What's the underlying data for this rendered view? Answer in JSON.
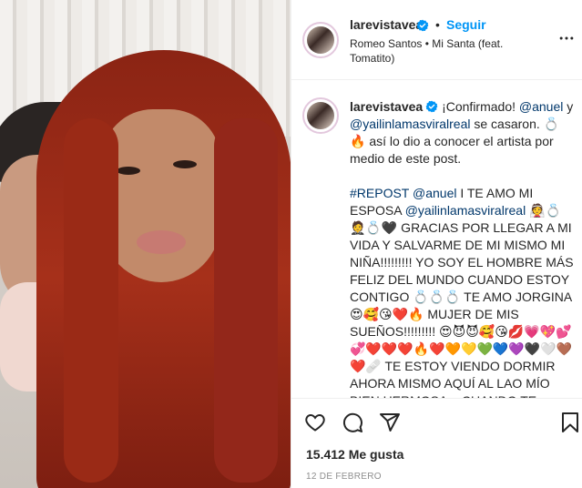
{
  "post": {
    "author": {
      "username": "larevistavea",
      "follow_label": "Seguir",
      "dot": "•"
    },
    "audio": "Romeo Santos • Mi Santa (feat. Tomatito)",
    "caption": {
      "username": "larevistavea",
      "intro_a": "¡Confirmado! ",
      "mention_1": "@anuel",
      "intro_b": " y ",
      "mention_2": "@yailinlamasviralreal",
      "intro_c": " se casaron. 💍🔥 así lo dio a conocer el artista por medio de este post.",
      "hashtag": "#REPOST",
      "mention_3": "@anuel",
      "body_a": " I TE AMO MI ESPOSA ",
      "mention_4": "@yailinlamasviralreal",
      "body_b": " 👰💍🤵💍🖤 GRACIAS POR LLEGAR A MI VIDA Y SALVARME DE MI MISMO MI NIÑA!!!!!!!!! YO SOY EL HOMBRE MÁS FELIZ DEL MUNDO CUANDO ESTOY CONTIGO 💍💍💍 TE AMO JORGINA 😍🥰😘❤️🔥 MUJER DE MIS SUEÑOS!!!!!!!!! 😍😈😈🥰😘💋💗💖💕💞❤️❤️❤️🔥❤️🧡💛💚💙💜🖤🤍🤎❤️🩹 TE ESTOY VIENDO DORMIR AHORA MISMO AQUÍ AL LAO MÍO BIEN HERMOSA... CUANDO TE LEVANTES YO SE O VAS A VER ESTO Y"
    },
    "likes": "15.412 Me gusta",
    "date": "12 DE FEBRERO",
    "icons": {
      "verified": "verified-badge-icon",
      "more": "more-options-icon",
      "like": "heart-icon",
      "comment": "comment-icon",
      "share": "send-icon",
      "save": "bookmark-icon"
    },
    "colors": {
      "link": "#0095f6",
      "mention": "#00376b",
      "text": "#262626",
      "muted": "#8e8e8e"
    }
  }
}
